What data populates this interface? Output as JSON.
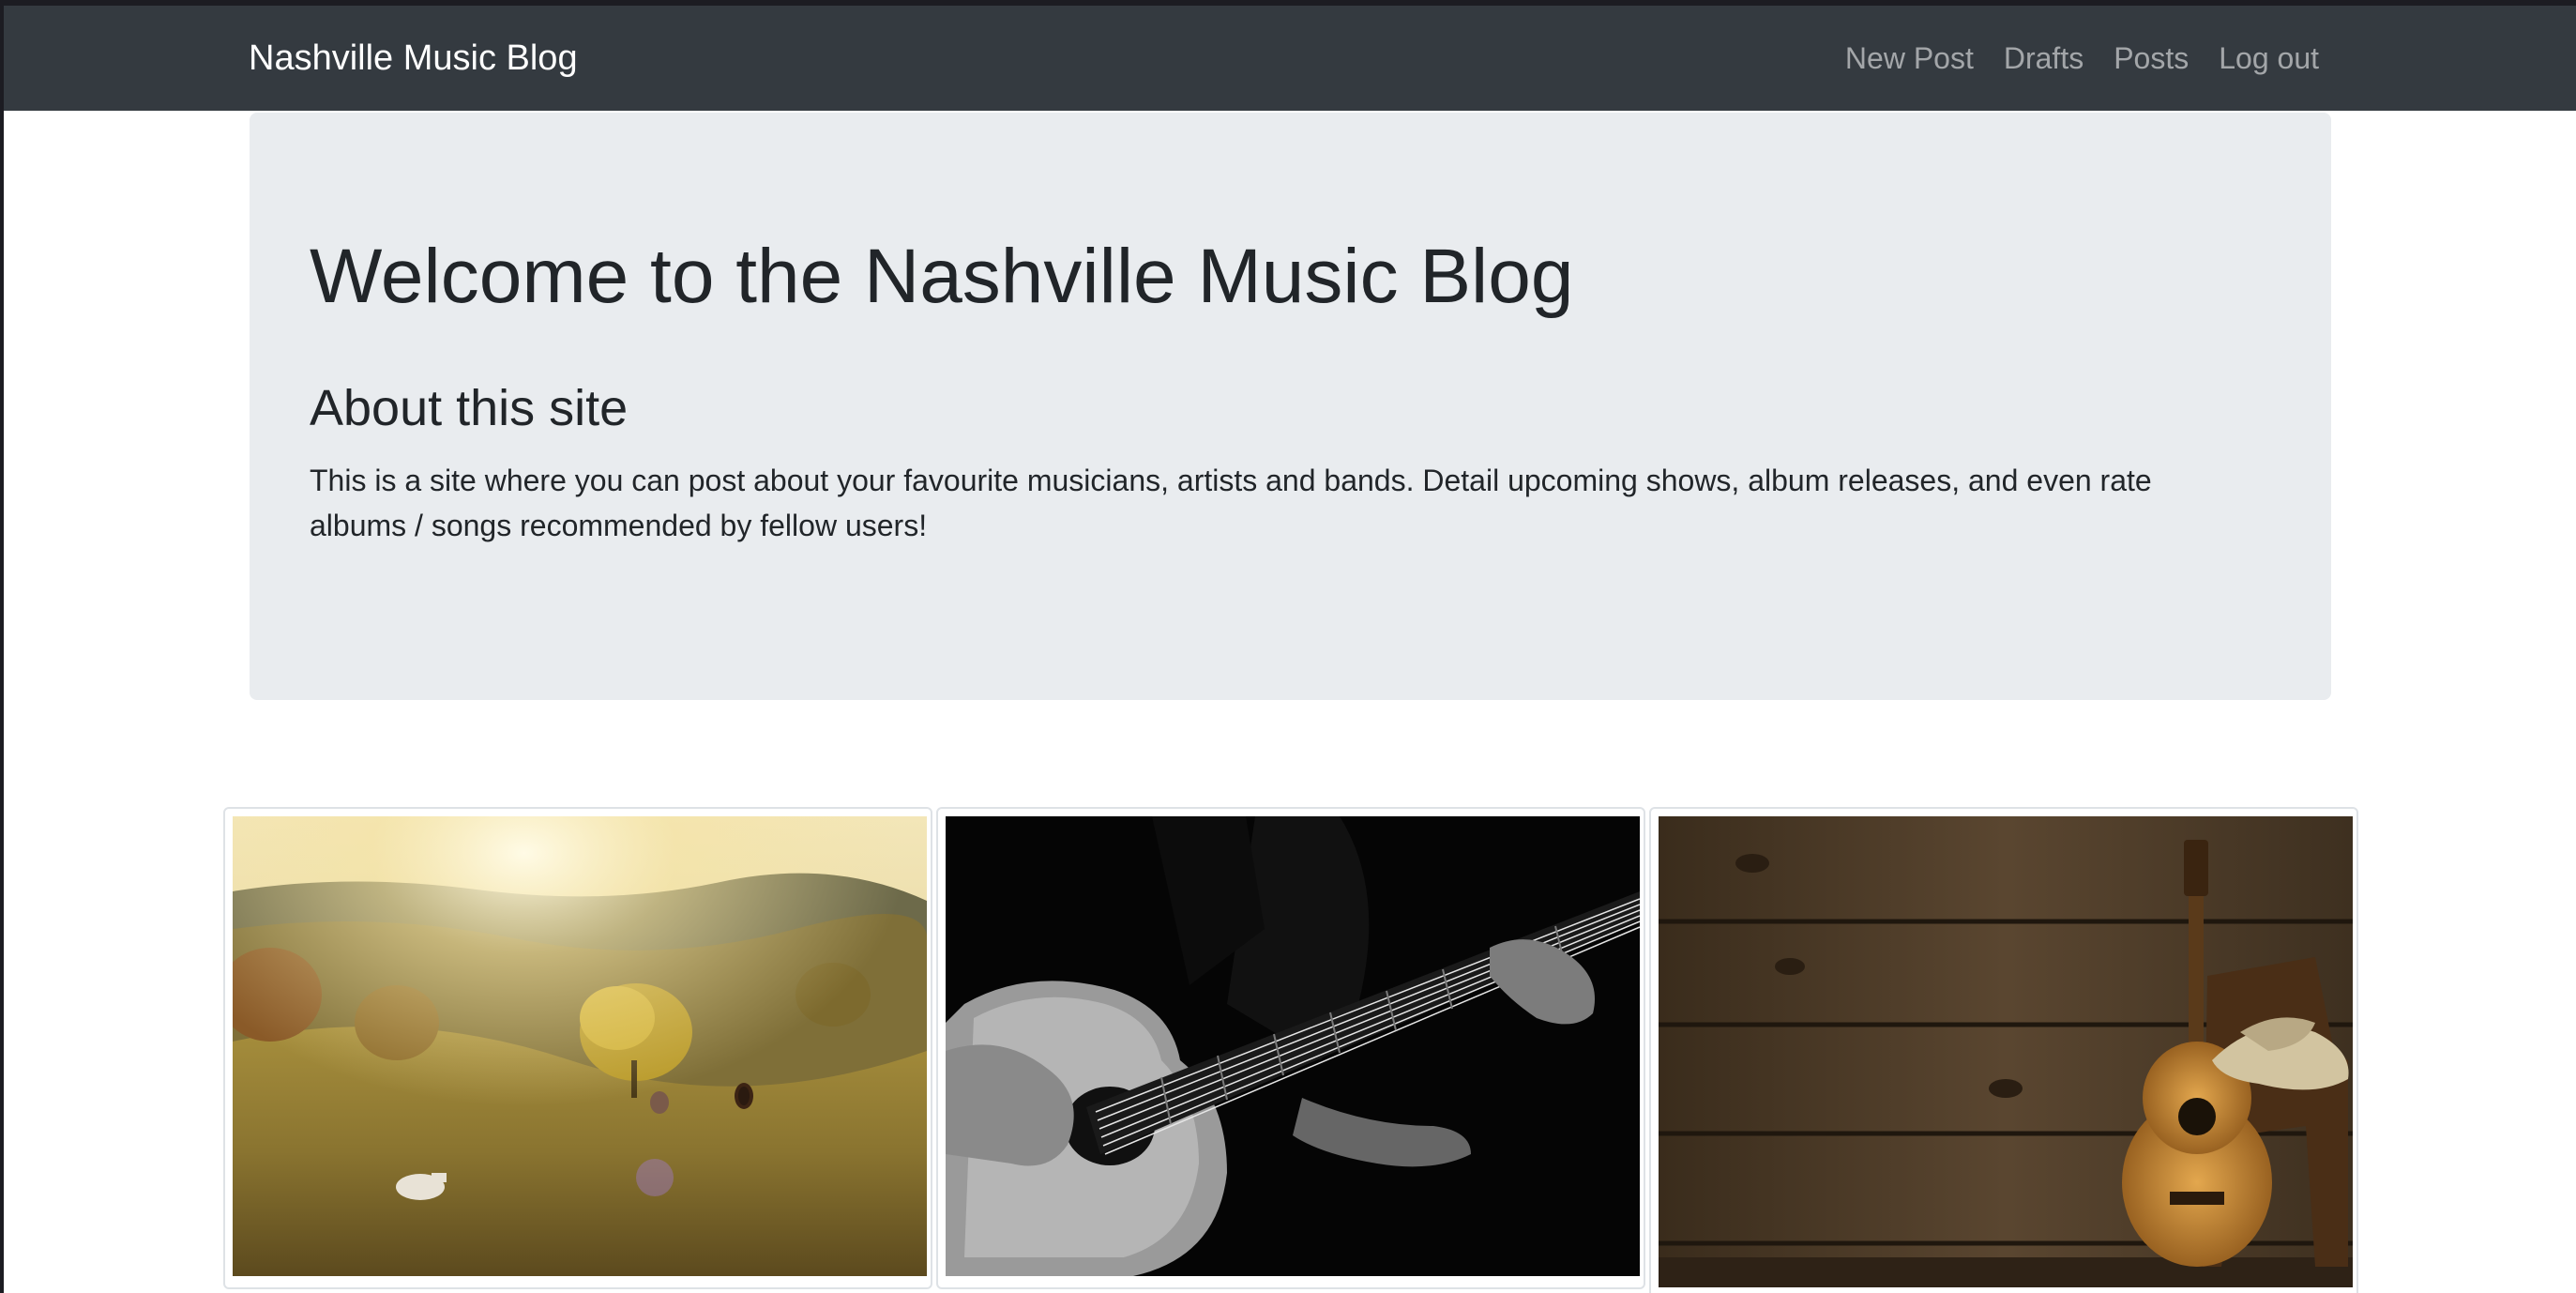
{
  "navbar": {
    "brand": "Nashville Music Blog",
    "links": [
      {
        "label": "New Post"
      },
      {
        "label": "Drafts"
      },
      {
        "label": "Posts"
      },
      {
        "label": "Log out"
      }
    ]
  },
  "hero": {
    "title": "Welcome to the Nashville Music Blog",
    "about_heading": "About this site",
    "about_text": "This is a site where you can post about your favourite musicians, artists and bands. Detail upcoming shows, album releases, and even rate albums / songs recommended by fellow users!"
  },
  "gallery": {
    "images": [
      {
        "subject": "sunlit-pasture-with-horses"
      },
      {
        "subject": "black-and-white-acoustic-guitar-player"
      },
      {
        "subject": "guitar-and-cowboy-hat-on-wooden-chair"
      }
    ]
  },
  "colors": {
    "navbar_bg": "#343a40",
    "brand_text": "#ffffff",
    "nav_link_text": "rgba(255,255,255,0.55)",
    "hero_bg": "#e9ecef",
    "body_text": "#212529"
  }
}
